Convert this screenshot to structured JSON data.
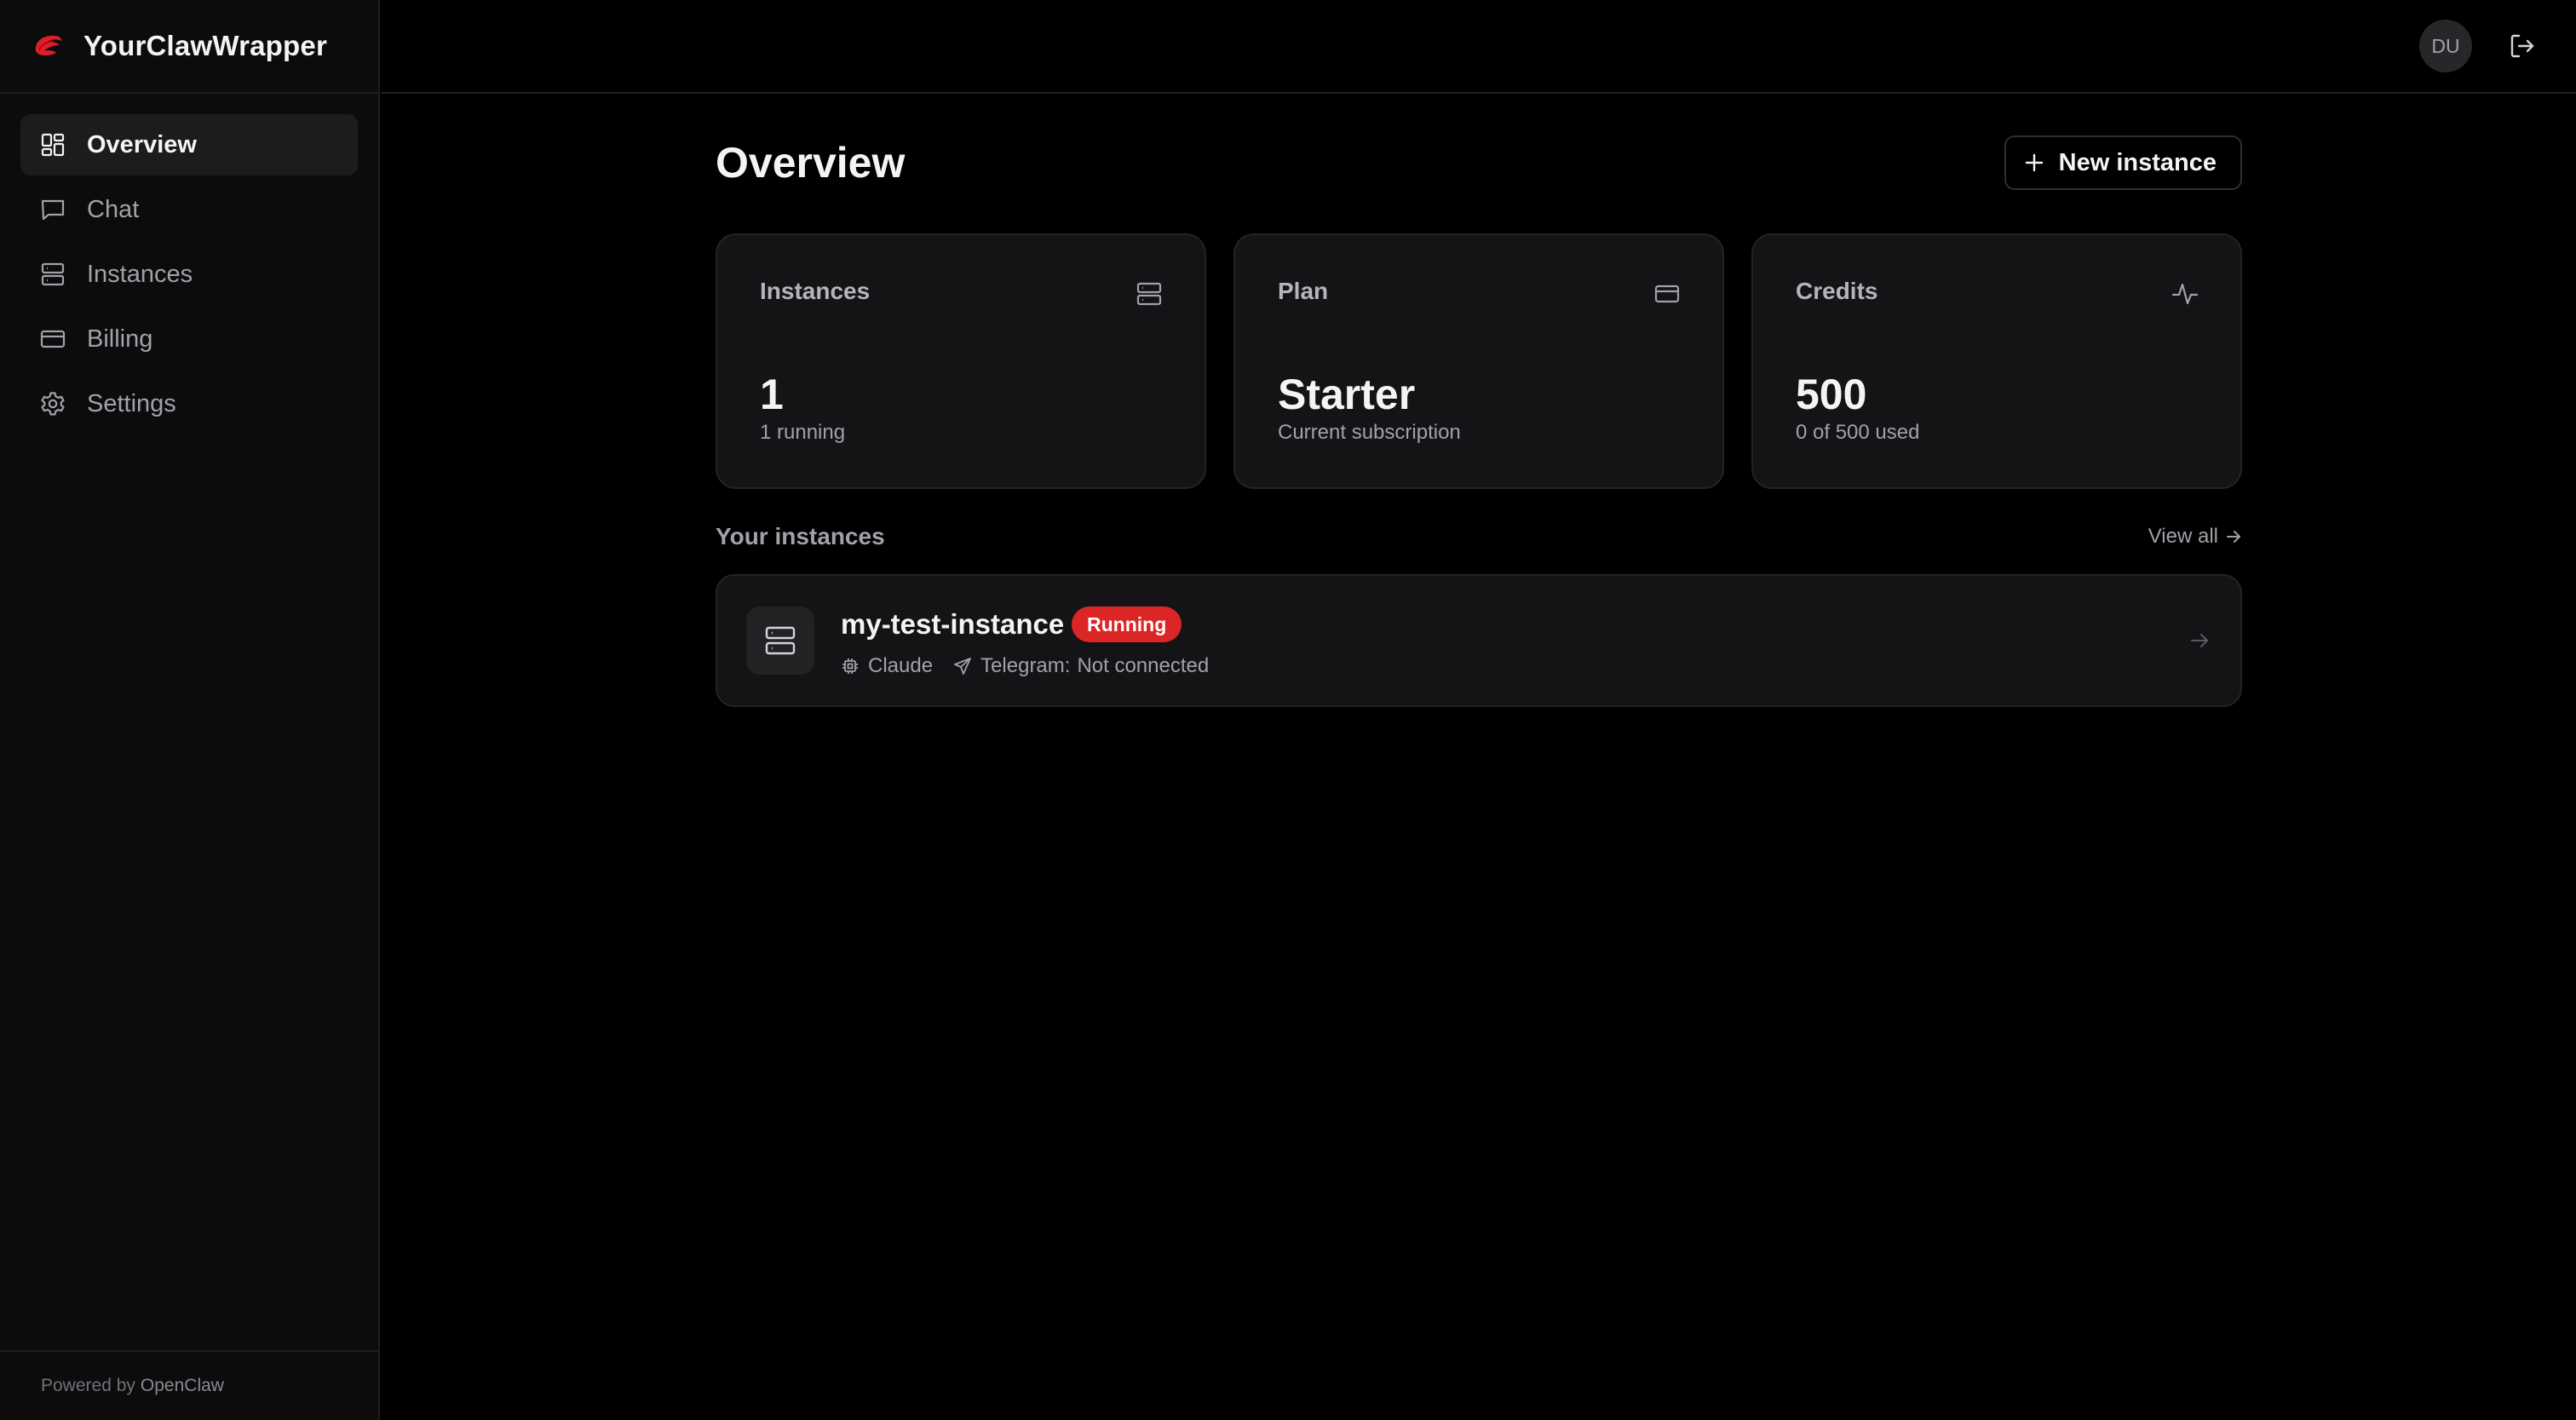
{
  "app": {
    "name": "YourClawWrapper",
    "logo_icon": "claw-logo"
  },
  "sidebar": {
    "items": [
      {
        "label": "Overview",
        "icon": "grid-icon",
        "active": true
      },
      {
        "label": "Chat",
        "icon": "chat-icon",
        "active": false
      },
      {
        "label": "Instances",
        "icon": "server-icon",
        "active": false
      },
      {
        "label": "Billing",
        "icon": "credit-card-icon",
        "active": false
      },
      {
        "label": "Settings",
        "icon": "gear-icon",
        "active": false
      }
    ],
    "footer_prefix": "Powered by",
    "footer_link": "OpenClaw"
  },
  "topbar": {
    "avatar_initials": "DU",
    "logout_icon": "logout-icon"
  },
  "main": {
    "title": "Overview",
    "new_instance_label": "New instance",
    "cards": [
      {
        "label": "Instances",
        "value": "1",
        "sub": "1 running",
        "icon": "server-icon"
      },
      {
        "label": "Plan",
        "value": "Starter",
        "sub": "Current subscription",
        "icon": "credit-card-icon"
      },
      {
        "label": "Credits",
        "value": "500",
        "sub": "0 of 500 used",
        "icon": "activity-icon"
      }
    ],
    "section_title": "Your instances",
    "view_all_label": "View all",
    "instances": [
      {
        "name": "my-test-instance",
        "status": "Running",
        "model": "Claude",
        "telegram_label": "Telegram:",
        "telegram_status": "Not connected"
      }
    ]
  },
  "colors": {
    "background": "#000000",
    "sidebar": "#0c0c0d",
    "card": "#141416",
    "accent": "#dc2626"
  }
}
